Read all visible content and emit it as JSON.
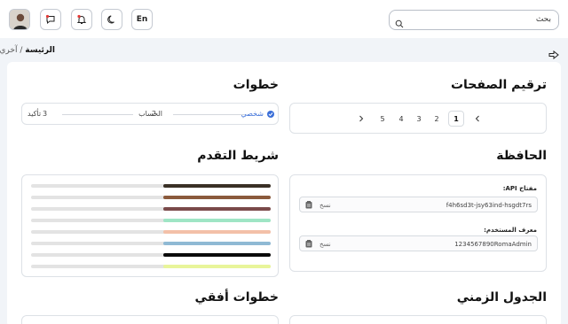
{
  "header": {
    "lang_button": "En",
    "search": {
      "text": "بحث"
    }
  },
  "breadcrumb": {
    "home": "الرئيسة",
    "separator": "/",
    "current": "آخري"
  },
  "sections": {
    "pagination": {
      "title": "ترقيم الصفحات",
      "pages": [
        "1",
        "2",
        "3",
        "4",
        "5"
      ],
      "active_page": "1"
    },
    "steps": {
      "title": "خطوات",
      "items": [
        {
          "number": "",
          "label": "شخصي",
          "done": true
        },
        {
          "number": "2",
          "label": "الحساب",
          "done": false
        },
        {
          "number": "3",
          "label": "تأكيد",
          "done": false
        }
      ]
    },
    "clipboard": {
      "title": "الحافظة",
      "fields": [
        {
          "label": "مفتاح API:",
          "value": "f4h6sd3t-jsy63ind-hsgdt7rs",
          "copy_label": "نسخ"
        },
        {
          "label": "معرف المستخدم:",
          "value": "1234567890RomaAdmin",
          "copy_label": "نسخ"
        }
      ]
    },
    "progress": {
      "title": "شريط التقدم",
      "bars": [
        {
          "value": 45,
          "color": "#3a3026"
        },
        {
          "value": 45,
          "color": "#8b5a3c"
        },
        {
          "value": 45,
          "color": "#7a4a4a"
        },
        {
          "value": 45,
          "color": "#9fe5c5"
        },
        {
          "value": 45,
          "color": "#f3c0a8"
        },
        {
          "value": 45,
          "color": "#8fb9d4"
        },
        {
          "value": 45,
          "color": "#0a0a0a"
        },
        {
          "value": 45,
          "color": "#e8f59a"
        }
      ]
    },
    "timeline": {
      "title": "الجدول الزمني"
    },
    "horizontal_steps": {
      "title": "خطوات أفقي"
    }
  }
}
